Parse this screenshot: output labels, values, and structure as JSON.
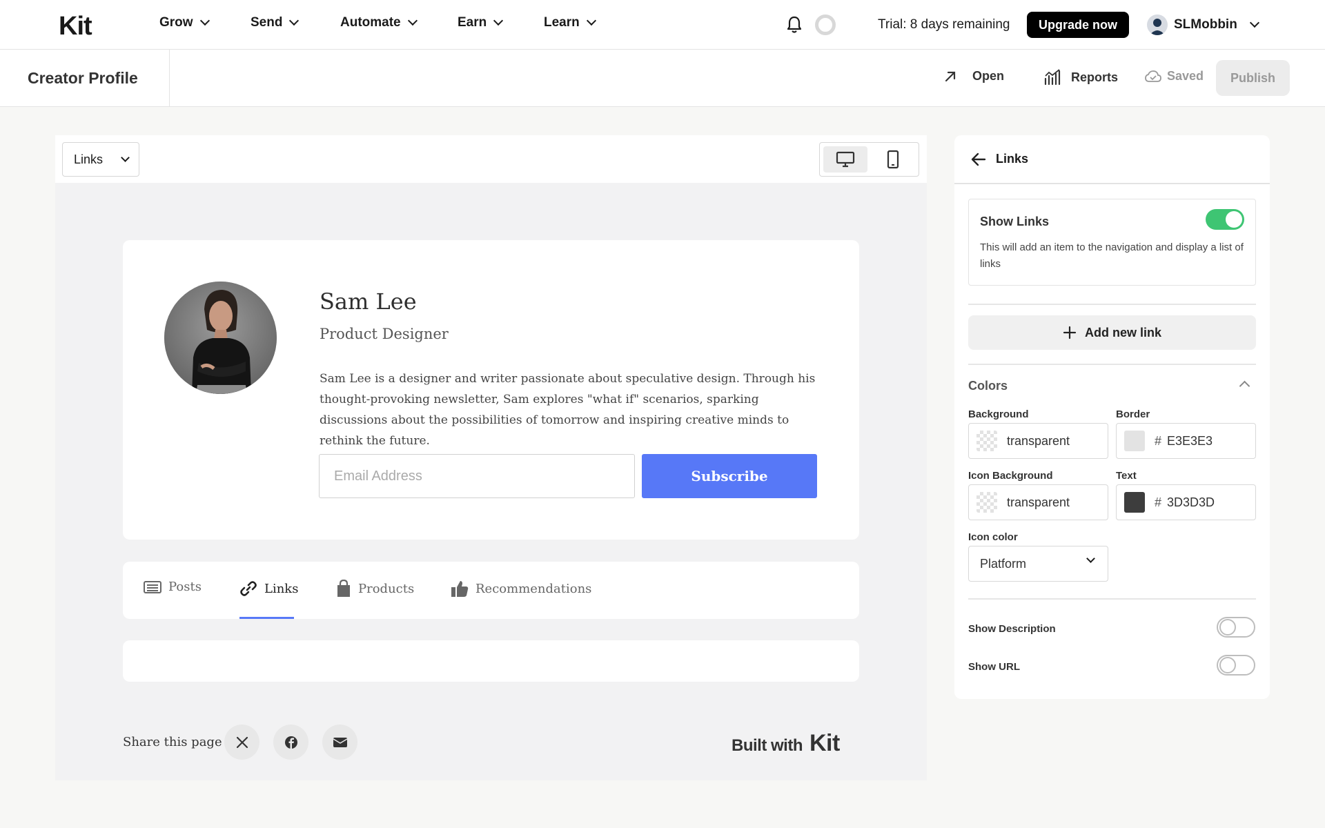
{
  "nav": {
    "logo": "Kit",
    "items": [
      {
        "label": "Grow"
      },
      {
        "label": "Send"
      },
      {
        "label": "Automate"
      },
      {
        "label": "Earn"
      },
      {
        "label": "Learn"
      }
    ],
    "trial_text": "Trial: 8 days remaining",
    "upgrade_label": "Upgrade now",
    "username": "SLMobbin"
  },
  "subheader": {
    "title": "Creator Profile",
    "open_label": "Open",
    "reports_label": "Reports",
    "saved_label": "Saved",
    "publish_label": "Publish"
  },
  "canvas": {
    "section_select": "Links",
    "profile": {
      "name": "Sam Lee",
      "role": "Product Designer",
      "bio": "Sam Lee is a designer and writer passionate about speculative design. Through his thought-provoking newsletter, Sam explores \"what if\" scenarios, sparking discussions about the possibilities of tomorrow and inspiring creative minds to rethink the future.",
      "email_placeholder": "Email Address",
      "subscribe_label": "Subscribe"
    },
    "tabs": [
      {
        "label": "Posts",
        "icon": "newspaper-icon"
      },
      {
        "label": "Links",
        "icon": "link-icon"
      },
      {
        "label": "Products",
        "icon": "shopping-bag-icon"
      },
      {
        "label": "Recommendations",
        "icon": "thumbs-up-icon"
      }
    ],
    "active_tab": "Links",
    "share_label": "Share this page",
    "built_with": "Built with",
    "built_logo": "Kit"
  },
  "panel": {
    "title": "Links",
    "show_links": {
      "title": "Show Links",
      "description": "This will add an item to the navigation and display a list of links",
      "enabled": true
    },
    "add_link_label": "Add new link",
    "colors_title": "Colors",
    "background": {
      "label": "Background",
      "value": "transparent"
    },
    "border": {
      "label": "Border",
      "value": "E3E3E3",
      "color": "#E3E3E3"
    },
    "icon_background": {
      "label": "Icon Background",
      "value": "transparent"
    },
    "text": {
      "label": "Text",
      "value": "3D3D3D",
      "color": "#3D3D3D"
    },
    "icon_color": {
      "label": "Icon color",
      "value": "Platform"
    },
    "show_description": {
      "label": "Show Description",
      "enabled": false
    },
    "show_url": {
      "label": "Show URL",
      "enabled": false
    }
  },
  "colors": {
    "accent_blue": "#5778F7",
    "toggle_on": "#3EC573"
  }
}
